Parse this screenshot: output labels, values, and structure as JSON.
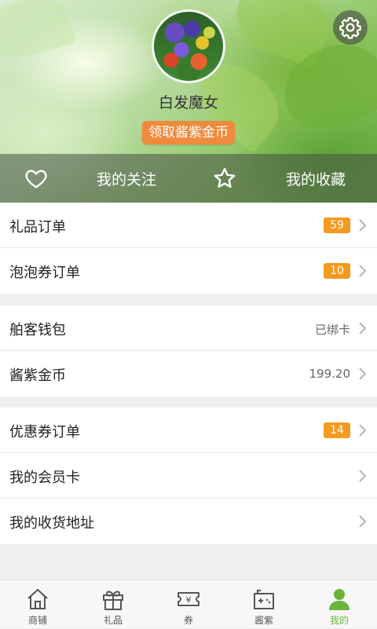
{
  "profile": {
    "username": "白发魔女",
    "claim_button": "领取酱紫金币"
  },
  "hero_bar": {
    "follow_label": "我的关注",
    "favorites_label": "我的收藏"
  },
  "groups": [
    {
      "rows": [
        {
          "title": "礼品订单",
          "badge": "59"
        },
        {
          "title": "泡泡券订单",
          "badge": "10"
        }
      ]
    },
    {
      "rows": [
        {
          "title": "舶客钱包",
          "value": "已绑卡"
        },
        {
          "title": "酱紫金币",
          "value": "199.20"
        }
      ]
    },
    {
      "rows": [
        {
          "title": "优惠券订单",
          "badge": "14"
        },
        {
          "title": "我的会员卡"
        },
        {
          "title": "我的收货地址"
        }
      ]
    }
  ],
  "tabbar": {
    "tabs": [
      {
        "label": "商铺",
        "icon": "house-icon"
      },
      {
        "label": "礼品",
        "icon": "gift-icon"
      },
      {
        "label": "券",
        "icon": "ticket-icon"
      },
      {
        "label": "酱紫",
        "icon": "gamepad-icon"
      },
      {
        "label": "我的",
        "icon": "person-icon"
      }
    ],
    "active_index": 4
  },
  "colors": {
    "accent_green": "#6ab43a",
    "badge_orange": "#f39a1f",
    "claim_orange": "#f08a3c"
  }
}
